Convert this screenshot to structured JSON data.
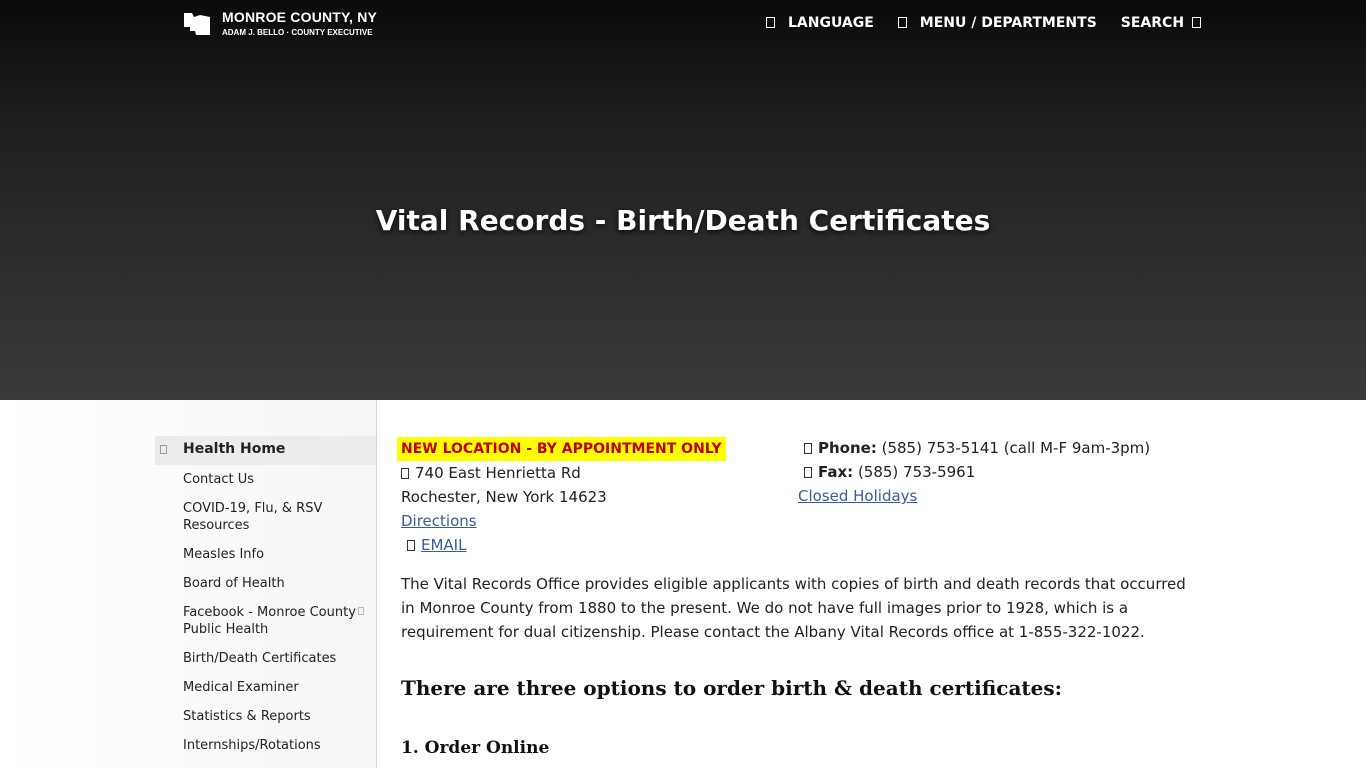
{
  "header": {
    "org_name": "MONROE COUNTY, NY",
    "executive": "ADAM J. BELLO · COUNTY EXECUTIVE",
    "nav": {
      "language": "LANGUAGE",
      "menu": "MENU / DEPARTMENTS",
      "search": "SEARCH"
    }
  },
  "hero": {
    "title": "Vital Records - Birth/Death Certificates"
  },
  "sidebar": {
    "items": [
      {
        "label": "Health Home",
        "active": true
      },
      {
        "label": "Contact Us"
      },
      {
        "label": "COVID-19, Flu, & RSV Resources"
      },
      {
        "label": "Measles Info"
      },
      {
        "label": "Board of Health"
      },
      {
        "label": "Facebook - Monroe County Public Health",
        "external": true
      },
      {
        "label": "Birth/Death Certificates"
      },
      {
        "label": "Medical Examiner"
      },
      {
        "label": "Statistics & Reports"
      },
      {
        "label": "Internships/Rotations"
      }
    ]
  },
  "contact": {
    "notice": "NEW LOCATION - BY APPOINTMENT ONLY",
    "address_line1": "740 East Henrietta Rd",
    "address_line2": "Rochester, New York 14623",
    "directions": "Directions",
    "email": "EMAIL",
    "phone_label": "Phone:",
    "phone_value": "(585) 753-5141 (call M-F 9am-3pm)",
    "fax_label": "Fax:",
    "fax_value": "(585) 753-5961",
    "holidays": "Closed Holidays"
  },
  "content": {
    "description": "The Vital Records Office provides eligible applicants with copies of birth and death records that occurred in Monroe County from 1880 to the present. We do not have full images prior to 1928, which is a requirement for dual citizenship. Please contact the Albany Vital Records office at 1-855-322-1022.",
    "options_heading": "There are three options to order birth & death certificates:",
    "option1_heading": "1. Order Online"
  }
}
